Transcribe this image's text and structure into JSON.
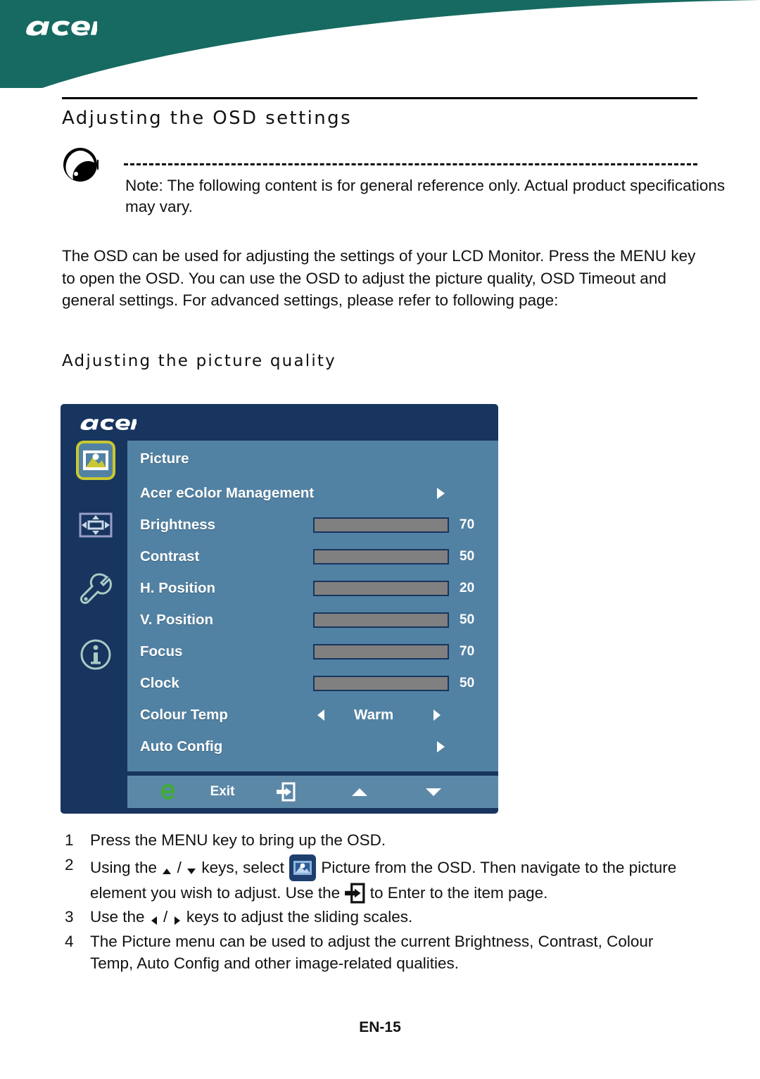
{
  "brand": {
    "logo_text": "acer",
    "header_color": "#166a61"
  },
  "page": {
    "title": "Adjusting the OSD settings",
    "subtitle": "Adjusting the picture quality",
    "page_number": "EN-15"
  },
  "note": {
    "icon": "acer-note-icon",
    "text": "Note: The following content is for general reference only. Actual product specifications may vary."
  },
  "body": {
    "paragraph": "The OSD can be used for adjusting the settings of your LCD Monitor. Press the MENU key to open the OSD. You can use the OSD to adjust the picture quality, OSD Timeout and general settings. For advanced settings, please refer to following page:"
  },
  "osd": {
    "logo_text": "acer",
    "colors": {
      "frame": "#17355f",
      "panel": "#5282a3",
      "footer": "#5c88a8",
      "slider_fill": "#9ec8ea",
      "slider_track": "#808080",
      "highlight": "#c8c832",
      "ecolor_green": "#3faa35"
    },
    "sidebar_icons": [
      {
        "name": "picture-icon",
        "selected": true
      },
      {
        "name": "position-icon",
        "selected": false
      },
      {
        "name": "wrench-icon",
        "selected": false
      },
      {
        "name": "info-icon",
        "selected": false
      }
    ],
    "menu_title": "Picture",
    "rows": [
      {
        "label": "Acer eColor Management",
        "type": "submenu"
      },
      {
        "label": "Brightness",
        "type": "slider",
        "value": 70
      },
      {
        "label": "Contrast",
        "type": "slider",
        "value": 50
      },
      {
        "label": "H. Position",
        "type": "slider",
        "value": 20
      },
      {
        "label": "V. Position",
        "type": "slider",
        "value": 50
      },
      {
        "label": "Focus",
        "type": "slider",
        "value": 70
      },
      {
        "label": "Clock",
        "type": "slider",
        "value": 50
      },
      {
        "label": "Colour Temp",
        "type": "option",
        "value": "Warm"
      },
      {
        "label": "Auto Config",
        "type": "submenu"
      }
    ],
    "footer": [
      {
        "name": "ecolor-e-icon",
        "label": ""
      },
      {
        "name": "exit-label",
        "label": "Exit"
      },
      {
        "name": "enter-icon",
        "label": ""
      },
      {
        "name": "up-arrow-icon",
        "label": ""
      },
      {
        "name": "down-arrow-icon",
        "label": ""
      }
    ]
  },
  "steps": [
    {
      "num": "1",
      "parts": [
        {
          "type": "text",
          "value": "Press the MENU key to bring up the OSD."
        }
      ]
    },
    {
      "num": "2",
      "parts": [
        {
          "type": "text",
          "value": "Using the "
        },
        {
          "type": "icon",
          "value": "up-triangle-icon"
        },
        {
          "type": "text",
          "value": " / "
        },
        {
          "type": "icon",
          "value": "down-triangle-icon"
        },
        {
          "type": "text",
          "value": " keys, select "
        },
        {
          "type": "icon",
          "value": "picture-badge-icon"
        },
        {
          "type": "text",
          "value": " Picture from the OSD. Then navigate to the picture element you wish to adjust. Use the "
        },
        {
          "type": "icon",
          "value": "enter-badge-icon"
        },
        {
          "type": "text",
          "value": " to Enter to the item page."
        }
      ]
    },
    {
      "num": "3",
      "parts": [
        {
          "type": "text",
          "value": "Use the "
        },
        {
          "type": "icon",
          "value": "left-triangle-icon"
        },
        {
          "type": "text",
          "value": " / "
        },
        {
          "type": "icon",
          "value": "right-triangle-icon"
        },
        {
          "type": "text",
          "value": " keys to adjust the sliding scales."
        }
      ]
    },
    {
      "num": "4",
      "parts": [
        {
          "type": "text",
          "value": "The Picture menu can be used to adjust the current Brightness, Contrast, Colour Temp, Auto Config and other image-related qualities."
        }
      ]
    }
  ]
}
